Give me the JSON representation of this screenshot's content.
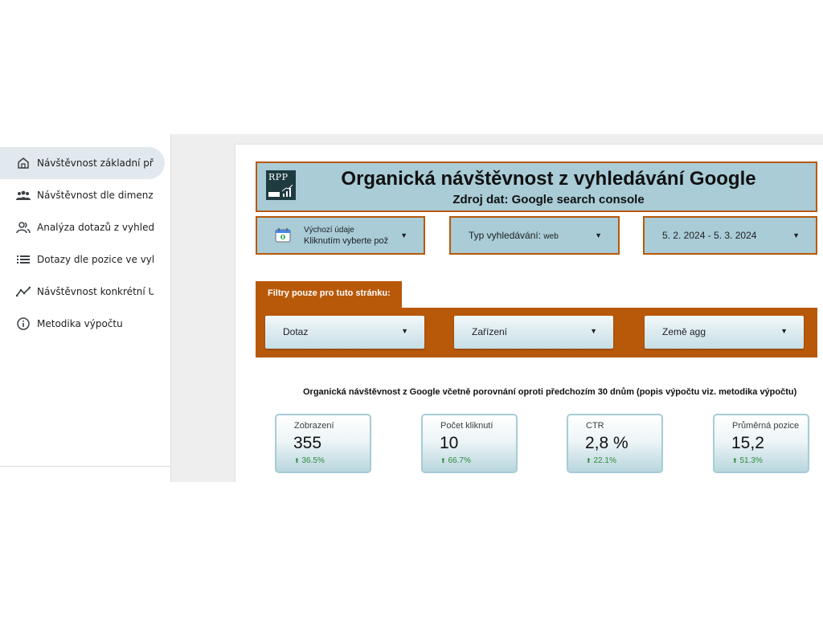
{
  "sidebar": {
    "items": [
      {
        "label": "Návštěvnost základní př…",
        "icon": "home-icon",
        "active": true
      },
      {
        "label": "Návštěvnost dle dimenzí",
        "icon": "people-group-icon"
      },
      {
        "label": "Analýza dotazů z vyhled…",
        "icon": "people-icon"
      },
      {
        "label": "Dotazy dle pozice ve vyh…",
        "icon": "list-icon"
      },
      {
        "label": "Návštěvnost konkrétní U…",
        "icon": "trend-line-icon"
      },
      {
        "label": "Metodika výpočtu",
        "icon": "info-icon"
      }
    ]
  },
  "header": {
    "logo_text": "RPP",
    "title": "Organická návštěvnost  z vyhledávání  Google",
    "subtitle": "Zdroj dat: Google search console"
  },
  "controls": {
    "data_source": {
      "line1": "Výchozí údaje",
      "line2": "Kliknutím vyberte pož"
    },
    "search_type": {
      "label": "Typ vyhledávání:",
      "value": "web"
    },
    "date_range": {
      "value": "5. 2. 2024 - 5. 3. 2024"
    }
  },
  "filters": {
    "tab_label": "Filtry pouze pro tuto stránku:",
    "dropdowns": [
      {
        "label": "Dotaz"
      },
      {
        "label": "Zařízení"
      },
      {
        "label": "Země agg"
      }
    ]
  },
  "summary": {
    "title": "Organická návštěvnost z Google včetně porovnání oproti předchozím 30 dnům (popis výpočtu viz. metodika výpočtu)",
    "cards": [
      {
        "label": "Zobrazení",
        "value": "355",
        "delta": "36.5%"
      },
      {
        "label": "Počet kliknutí",
        "value": "10",
        "delta": "66.7%"
      },
      {
        "label": "CTR",
        "value": "2,8 %",
        "delta": "22.1%"
      },
      {
        "label": "Průměrná pozice",
        "value": "15,2",
        "delta": "51.3%"
      }
    ],
    "delta_arrow": "⬆"
  },
  "colors": {
    "accent": "#b8590a",
    "header_bg": "#a9ccd7",
    "positive": "#2e8b3d"
  }
}
